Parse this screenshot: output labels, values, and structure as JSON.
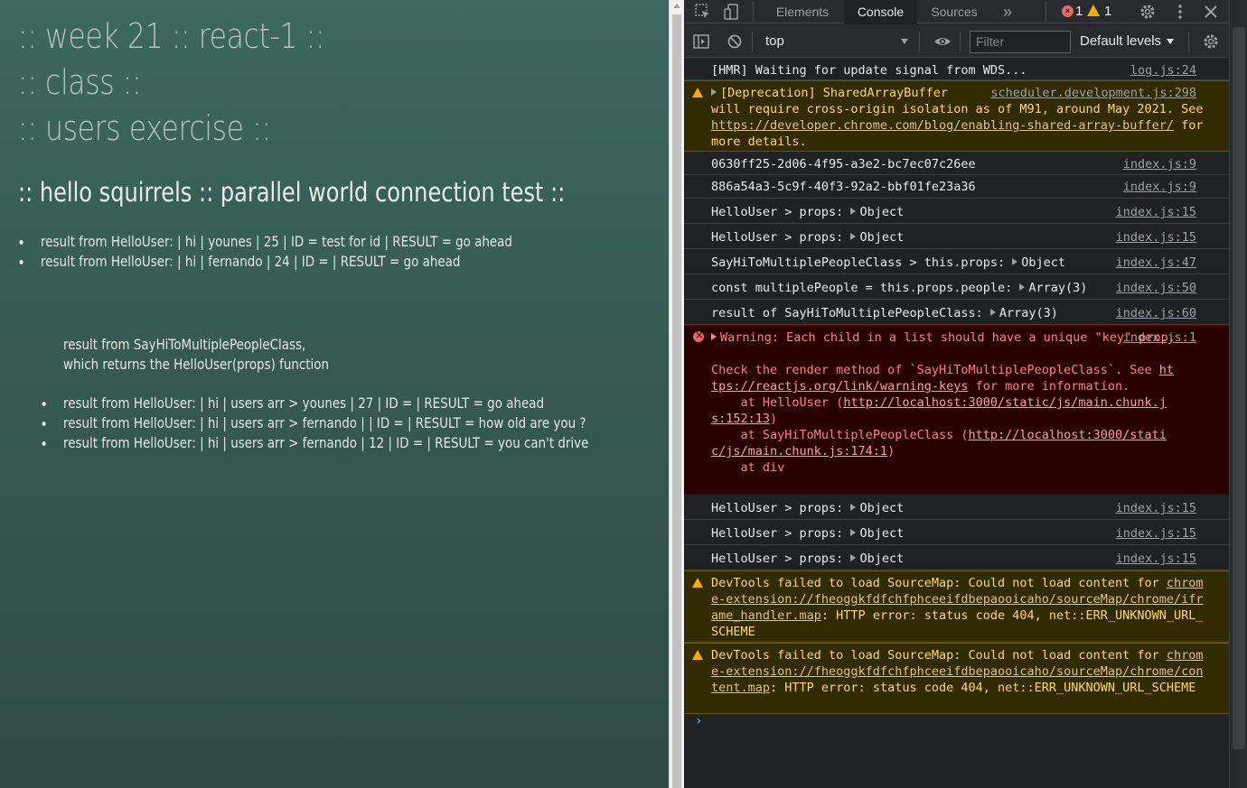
{
  "app": {
    "headings": [
      ":: week 21 :: react-1 ::",
      ":: class ::",
      ":: users exercise ::"
    ],
    "subheading": ":: hello squirrels :: parallel world connection test ::",
    "list1": [
      "result from HelloUser:   | hi   | younes |   25  |   ID =    test for id   |   RESULT =    go ahead",
      "result from HelloUser:   | hi   | fernando |   24  |   ID =      |   RESULT =    go ahead"
    ],
    "paragraph_line1": "result from SayHiToMultiplePeopleClass,",
    "paragraph_line2": "which returns the HelloUser(props) function",
    "list2": [
      "result from HelloUser:   | hi   | users arr > younes |   27  |   ID =      |   RESULT =    go ahead",
      "result from HelloUser:   | hi   | users arr > fernando |     |   ID =      |   RESULT =    how old are you ?",
      "result from HelloUser:   | hi   | users arr > fernando |   12  |   ID =      |   RESULT =    you can't drive"
    ]
  },
  "devtools": {
    "tabs": [
      "Elements",
      "Console",
      "Sources"
    ],
    "more_tabs": "»",
    "error_count": "1",
    "warning_count": "1",
    "context": "top",
    "filter_placeholder": "Filter",
    "levels": "Default levels",
    "colors": {
      "error_bg": "#290000",
      "warning_bg": "#332b00",
      "link": "#a8c7fa"
    }
  },
  "console": {
    "m1": {
      "text": "[HMR] Waiting for update signal from WDS...",
      "src": "log.js:24"
    },
    "m2": {
      "a": "[Deprecation] SharedArrayBuffer",
      "b": "will require cross-origin isolation as of M91, around May 2021. See ",
      "link": "https://developer.chrome.com/blog/enabling-shared-array-buffer/",
      "c": " for more details.",
      "src": "scheduler.development.js:298"
    },
    "m3": {
      "text": "0630ff25-2d06-4f95-a3e2-bc7ec07c26ee",
      "src": "index.js:9"
    },
    "m4": {
      "text": "886a54a3-5c9f-40f3-92a2-bbf01fe23a36",
      "src": "index.js:9"
    },
    "m5": {
      "text": "HelloUser > props: ",
      "obj": "Object",
      "src": "index.js:15"
    },
    "m6": {
      "text": "HelloUser > props: ",
      "obj": "Object",
      "src": "index.js:15"
    },
    "m7": {
      "text": "SayHiToMultiplePeopleClass > this.props: ",
      "obj": "Object",
      "src": "index.js:47"
    },
    "m8": {
      "text": "const multiplePeople = this.props.people: ",
      "obj": "Array(3)",
      "src": "index.js:50"
    },
    "m9": {
      "text": "result of SayHiToMultiplePeopleClass: ",
      "obj": "Array(3)",
      "src": "index.js:60"
    },
    "m10": {
      "a": "Warning: Each child in a list should have a unique \"key\" prop.\n\nCheck the render method of `SayHiToMultiplePeopleClass`. See ",
      "link1": "https://reactjs.org/link/warning-keys",
      "b": " for more information.\n    at HelloUser (",
      "link2": "http://localhost:3000/static/js/main.chunk.js:152:13",
      "c": ")\n    at SayHiToMultiplePeopleClass (",
      "link3": "http://localhost:3000/static/js/main.chunk.js:174:1",
      "d": ")\n    at div",
      "src": "index.js:1"
    },
    "m11": {
      "text": "HelloUser > props: ",
      "obj": "Object",
      "src": "index.js:15"
    },
    "m12": {
      "text": "HelloUser > props: ",
      "obj": "Object",
      "src": "index.js:15"
    },
    "m13": {
      "text": "HelloUser > props: ",
      "obj": "Object",
      "src": "index.js:15"
    },
    "m14": {
      "a": "DevTools failed to load SourceMap: Could not load content for ",
      "link": "chrome-extension://fheoggkfdfchfphceeifdbepaooicaho/sourceMap/chrome/iframe_handler.map",
      "b": ": HTTP error: status code 404, net::ERR_UNKNOWN_URL_SCHEME"
    },
    "m15": {
      "a": "DevTools failed to load SourceMap: Could not load content for ",
      "link": "chrome-extension://fheoggkfdfchfphceeifdbepaooicaho/sourceMap/chrome/content.map",
      "b": ": HTTP error: status code 404, net::ERR_UNKNOWN_URL_SCHEME"
    },
    "prompt": "›"
  }
}
